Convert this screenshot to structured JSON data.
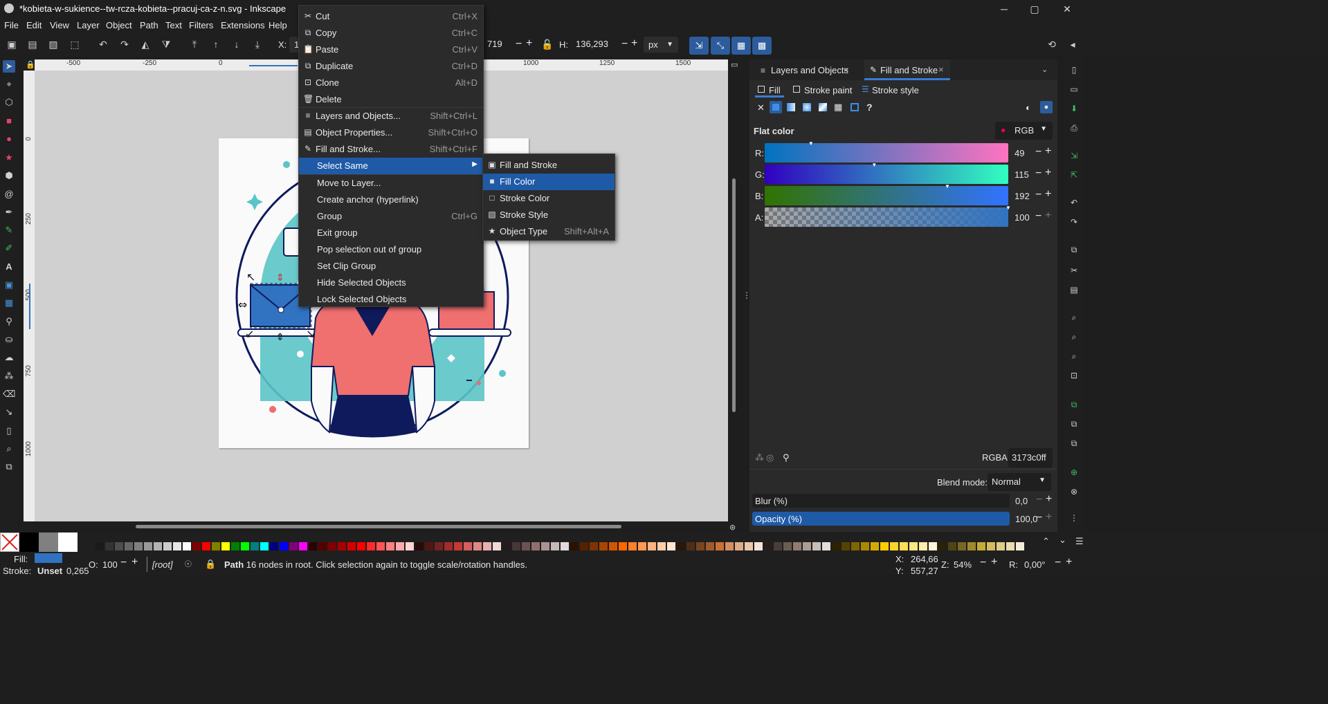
{
  "window": {
    "title": "*kobieta-w-sukience--tw-rcza-kobieta--pracuj-ca-z-n.svg - Inkscape",
    "minimize": "─",
    "maximize": "▢",
    "close": "✕"
  },
  "menubar": [
    "File",
    "Edit",
    "View",
    "Layer",
    "Object",
    "Path",
    "Text",
    "Filters",
    "Extensions",
    "Help"
  ],
  "toolbar": {
    "x_label": "X:",
    "x_value": "10",
    "w_value": "719",
    "h_label": "H:",
    "h_value": "136,293",
    "unit": "px",
    "minus": "−",
    "plus": "+"
  },
  "ruler_labels": [
    "-500",
    "-250",
    "0",
    "",
    "1000",
    "1250",
    "1500"
  ],
  "vruler_labels": [
    "0",
    "250",
    "500",
    "750",
    "1000"
  ],
  "context_menu": {
    "items": [
      {
        "label": "Cut",
        "shortcut": "Ctrl+X",
        "icon": "scissors-icon",
        "glyph": "✂"
      },
      {
        "label": "Copy",
        "shortcut": "Ctrl+C",
        "icon": "copy-icon",
        "glyph": "⧉"
      },
      {
        "label": "Paste",
        "shortcut": "Ctrl+V",
        "icon": "paste-icon",
        "glyph": "📋"
      },
      {
        "label": "Duplicate",
        "shortcut": "Ctrl+D",
        "icon": "duplicate-icon",
        "glyph": "⧉"
      },
      {
        "label": "Clone",
        "shortcut": "Alt+D",
        "icon": "clone-icon",
        "glyph": "⊡"
      },
      {
        "label": "Delete",
        "shortcut": "",
        "icon": "trash-icon",
        "glyph": "🗑"
      },
      {
        "label": "Layers and Objects...",
        "shortcut": "Shift+Ctrl+L",
        "icon": "layers-icon",
        "glyph": "≡"
      },
      {
        "label": "Object Properties...",
        "shortcut": "Shift+Ctrl+O",
        "icon": "object-properties-icon",
        "glyph": "▤"
      },
      {
        "label": "Fill and Stroke...",
        "shortcut": "Shift+Ctrl+F",
        "icon": "fill-stroke-icon",
        "glyph": "✎"
      },
      {
        "label": "Select Same",
        "shortcut": "",
        "icon": "",
        "glyph": ""
      },
      {
        "label": "Move to Layer...",
        "shortcut": "",
        "icon": "",
        "glyph": ""
      },
      {
        "label": "Create anchor (hyperlink)",
        "shortcut": "",
        "icon": "",
        "glyph": ""
      },
      {
        "label": "Group",
        "shortcut": "Ctrl+G",
        "icon": "",
        "glyph": ""
      },
      {
        "label": "Exit group",
        "shortcut": "",
        "icon": "",
        "glyph": ""
      },
      {
        "label": "Pop selection out of group",
        "shortcut": "",
        "icon": "",
        "glyph": ""
      },
      {
        "label": "Set Clip Group",
        "shortcut": "",
        "icon": "",
        "glyph": ""
      },
      {
        "label": "Hide Selected Objects",
        "shortcut": "",
        "icon": "",
        "glyph": ""
      },
      {
        "label": "Lock Selected Objects",
        "shortcut": "",
        "icon": "",
        "glyph": ""
      }
    ],
    "submenu_arrow": "▶"
  },
  "submenu": {
    "items": [
      {
        "label": "Fill and Stroke",
        "shortcut": ""
      },
      {
        "label": "Fill Color",
        "shortcut": ""
      },
      {
        "label": "Stroke Color",
        "shortcut": ""
      },
      {
        "label": "Stroke Style",
        "shortcut": ""
      },
      {
        "label": "Object Type",
        "shortcut": "Shift+Alt+A"
      }
    ]
  },
  "panel": {
    "tabs": [
      {
        "label": "Layers and Objects",
        "close": "×"
      },
      {
        "label": "Fill and Stroke",
        "close": "×"
      }
    ],
    "subtabs": [
      "Fill",
      "Stroke paint",
      "Stroke style"
    ],
    "flat_color_label": "Flat color",
    "color_mode": "RGB",
    "channels": [
      {
        "label": "R:",
        "value": "49",
        "level": 0.19
      },
      {
        "label": "G:",
        "value": "115",
        "level": 0.45
      },
      {
        "label": "B:",
        "value": "192",
        "level": 0.75
      },
      {
        "label": "A:",
        "value": "100",
        "level": 1.0
      }
    ],
    "rgba_label": "RGBA:",
    "rgba_value": "3173c0ff",
    "blend_label": "Blend mode:",
    "blend_value": "Normal",
    "blur_label": "Blur (%)",
    "blur_value": "0,0",
    "opacity_label": "Opacity (%)",
    "opacity_value": "100,0",
    "help": "?"
  },
  "status": {
    "fill_label": "Fill:",
    "stroke_label": "Stroke:",
    "stroke_value": "Unset",
    "stroke_width": "0,265",
    "opacity_label": "O:",
    "opacity_value": "100",
    "layer": "[root]",
    "message_bold": "Path",
    "message": " 16 nodes in root. Click selection again to toggle scale/rotation handles.",
    "x_label": "X:",
    "x_value": "264,66",
    "y_label": "Y:",
    "y_value": "557,27",
    "zoom_label": "Z:",
    "zoom_value": "54%",
    "rot_label": "R:",
    "rot_value": "0,00°"
  },
  "colors": {
    "fill_color": "#3173c0",
    "accent": "#1f5aa7"
  }
}
